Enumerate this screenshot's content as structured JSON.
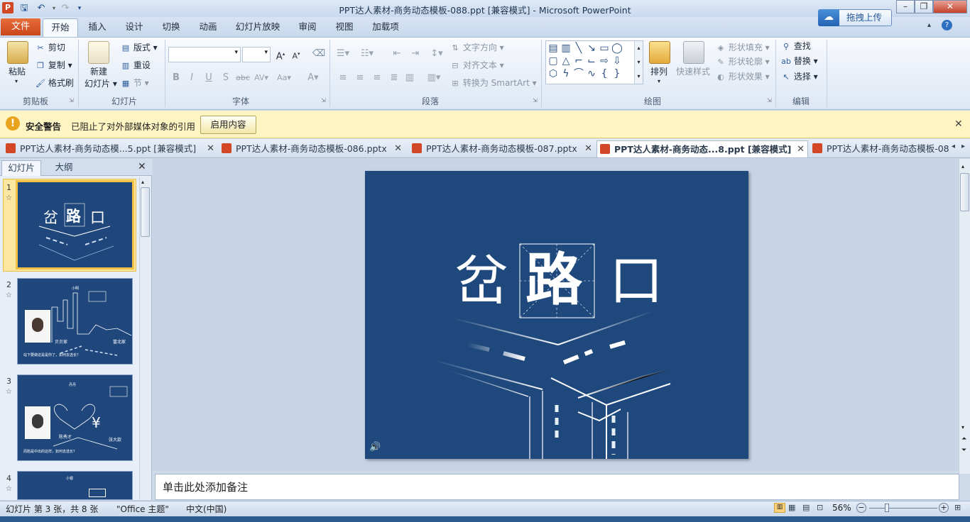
{
  "window": {
    "title": "PPT达人素材-商务动态模板-088.ppt [兼容模式]  -  Microsoft PowerPoint",
    "upload_label": "拖拽上传"
  },
  "ribbon_tabs": {
    "file": "文件",
    "items": [
      "开始",
      "插入",
      "设计",
      "切换",
      "动画",
      "幻灯片放映",
      "审阅",
      "视图",
      "加载项"
    ]
  },
  "ribbon": {
    "clipboard": {
      "label": "剪贴板",
      "paste": "粘贴",
      "cut": "剪切",
      "copy": "复制",
      "format_painter": "格式刷"
    },
    "slides": {
      "label": "幻灯片",
      "new_slide": "新建",
      "new_slide2": "幻灯片",
      "layout": "版式",
      "reset": "重设",
      "section": "节"
    },
    "font": {
      "label": "字体"
    },
    "paragraph": {
      "label": "段落",
      "text_direction": "文字方向",
      "align_text": "对齐文本",
      "smartart": "转换为 SmartArt"
    },
    "drawing": {
      "label": "绘图",
      "arrange": "排列",
      "quick_styles": "快速样式",
      "shape_fill": "形状填充",
      "shape_outline": "形状轮廓",
      "shape_effects": "形状效果"
    },
    "editing": {
      "label": "编辑",
      "find": "查找",
      "replace": "替换",
      "select": "选择"
    }
  },
  "security_bar": {
    "title": "安全警告",
    "message": "已阻止了对外部媒体对象的引用",
    "button": "启用内容"
  },
  "doc_tabs": [
    {
      "label": "PPT达人素材-商务动态模...5.ppt [兼容模式]",
      "active": false
    },
    {
      "label": "PPT达人素材-商务动态模板-086.pptx",
      "active": false
    },
    {
      "label": "PPT达人素材-商务动态模板-087.pptx",
      "active": false
    },
    {
      "label": "PPT达人素材-商务动态...8.ppt [兼容模式]",
      "active": true
    },
    {
      "label": "PPT达人素材-商务动态模板-08",
      "active": false
    }
  ],
  "pane_tabs": {
    "slides": "幻灯片",
    "outline": "大纲"
  },
  "thumbnails": {
    "numbers": [
      "1",
      "2",
      "3",
      "4"
    ],
    "s1_title": [
      "岔",
      "路",
      "口"
    ],
    "s2": {
      "head": "小明",
      "name1": "贝贝家",
      "name2": "富北家",
      "caption": "站下要做这是是你了，如何去选长？"
    },
    "s3": {
      "head": "丹丹",
      "name1": "陈秀才",
      "name2": "张大款",
      "caption": "而陷是中出的这样，如何去选长？"
    },
    "s4": {
      "head": "小银"
    }
  },
  "slide": {
    "title_chars": [
      "岔",
      "路",
      "口"
    ]
  },
  "notes_placeholder": "单击此处添加备注",
  "status": {
    "slide_info": "幻灯片 第 3 张，共 8 张",
    "theme": "\"Office 主题\"",
    "language": "中文(中国)",
    "zoom": "56%"
  }
}
